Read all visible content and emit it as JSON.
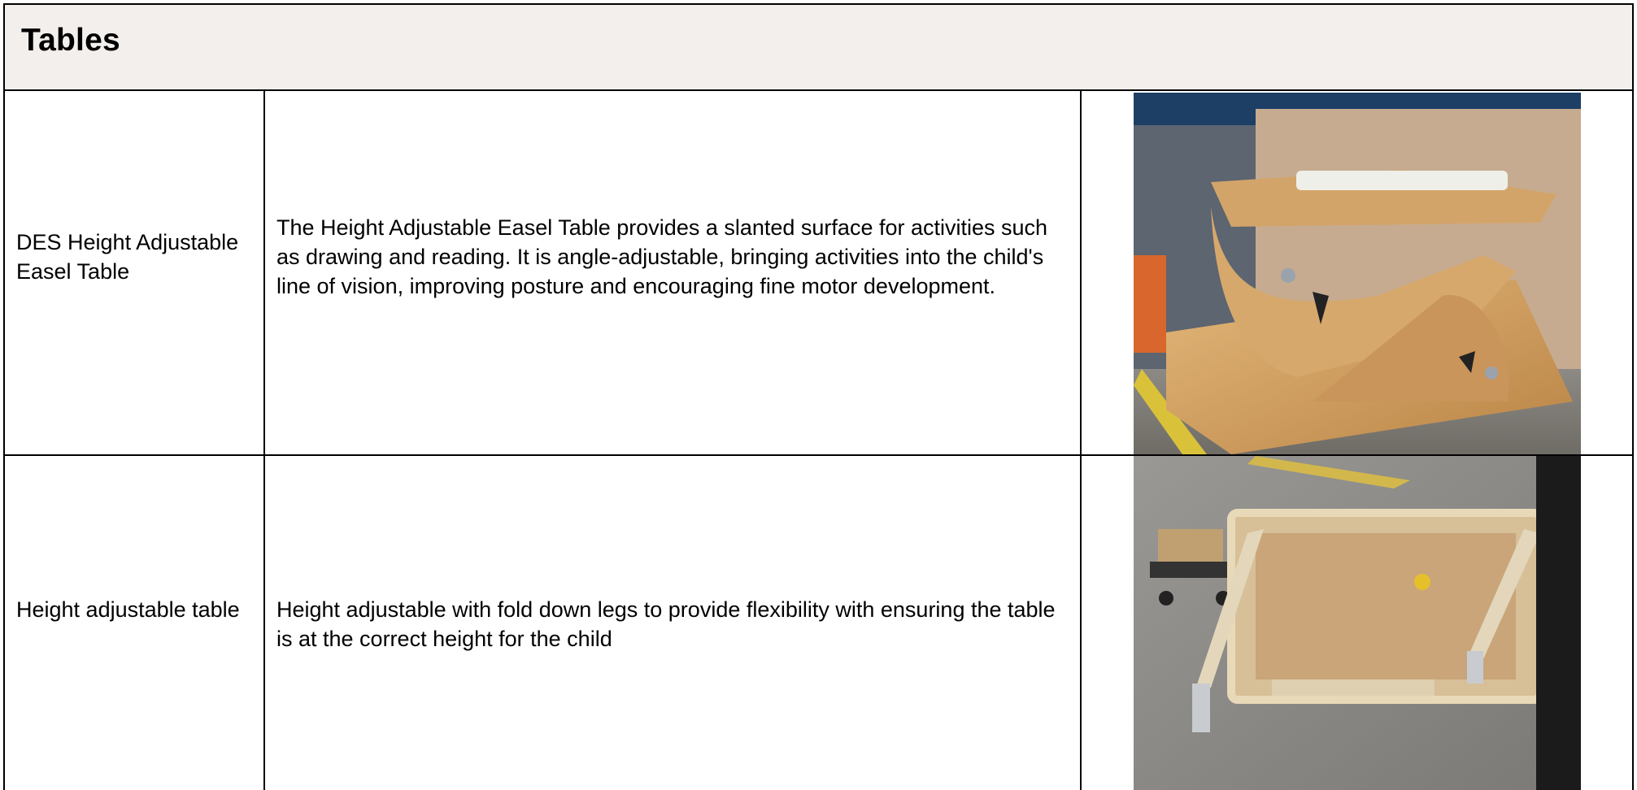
{
  "section": {
    "title": "Tables"
  },
  "rows": [
    {
      "name": "DES Height Adjustable Easel Table",
      "description": "The Height Adjustable Easel Table provides a slanted surface for activities such as drawing and reading. It is angle-adjustable, bringing activities into the child's line of vision, improving posture and encouraging fine motor development.",
      "photo": "easel-table-photo"
    },
    {
      "name": "Height adjustable table",
      "description": "Height adjustable with fold down legs to provide flexibility with ensuring the table is at the correct height for the child",
      "photo": "folding-table-photo"
    }
  ]
}
